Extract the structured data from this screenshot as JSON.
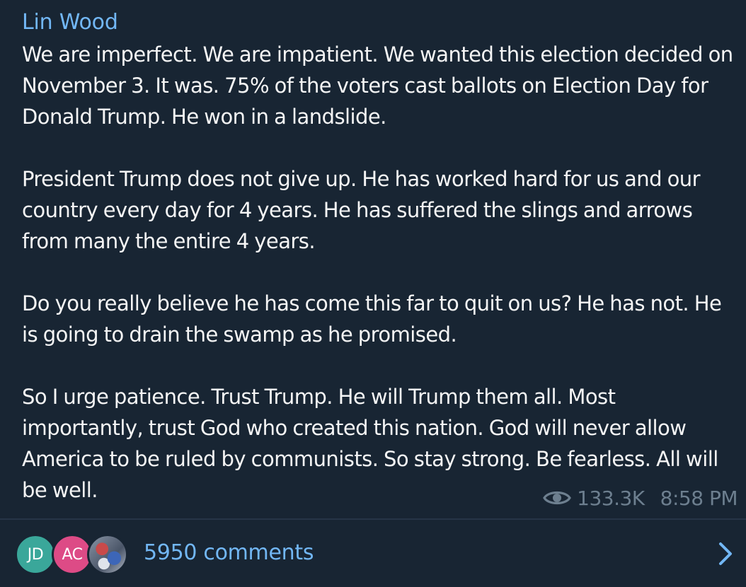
{
  "message": {
    "author": "Lin Wood",
    "paragraphs": [
      "We are imperfect. We are impatient. We wanted this election decided on November 3. It was. 75% of the voters cast ballots on Election Day for Donald Trump. He won in a landslide.",
      "President Trump does not give up. He has worked hard for us and our country every day for 4 years. He has suffered the slings and arrows from many the entire 4 years.",
      "Do you really believe he has come this far to quit on us? He has not. He is going to drain the swamp as he promised.",
      "So I urge patience. Trust Trump. He will Trump them all. Most importantly, trust God who created this nation. God will never allow America to be ruled by communists. So stay strong. Be fearless. All will be well."
    ],
    "views": "133.3K",
    "time": "8:58 PM",
    "views_icon": "eye-icon"
  },
  "comments": {
    "avatars": [
      {
        "initials": "JD",
        "color": "#3aa79a"
      },
      {
        "initials": "AC",
        "color": "#dd4b86"
      },
      {
        "initials": "",
        "color": "#6b7788"
      }
    ],
    "label": "5950 comments",
    "arrow_icon": "chevron-right-icon"
  },
  "colors": {
    "background": "#182533",
    "author": "#72b7f5",
    "text": "#f5f5f5",
    "meta": "#6d7f8f",
    "link": "#72b7f5"
  }
}
